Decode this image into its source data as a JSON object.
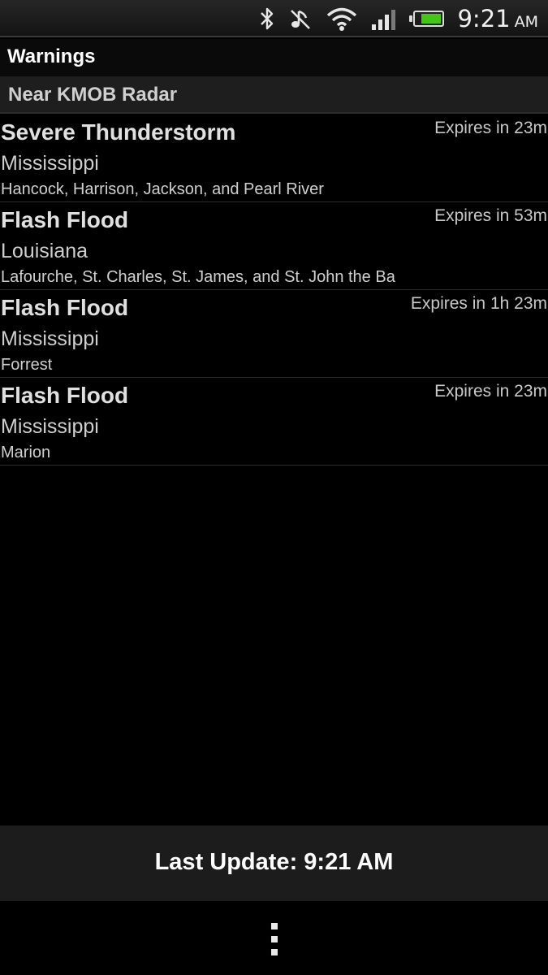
{
  "status_bar": {
    "time": "9:21",
    "ampm": "AM",
    "icons": [
      "bluetooth-icon",
      "muted-icon",
      "wifi-icon",
      "signal-icon",
      "battery-icon"
    ],
    "battery_color": "#45c41a",
    "battery_level": 0.85
  },
  "title_bar": {
    "title": "Warnings"
  },
  "section": {
    "header": "Near KMOB Radar"
  },
  "warnings": [
    {
      "type": "Severe Thunderstorm",
      "expires": "Expires in 23m",
      "state": "Mississippi",
      "counties": "Hancock, Harrison, Jackson, and Pearl River"
    },
    {
      "type": "Flash Flood",
      "expires": "Expires in 53m",
      "state": "Louisiana",
      "counties": "Lafourche, St. Charles, St. James, and St. John the Ba"
    },
    {
      "type": "Flash Flood",
      "expires": "Expires in 1h 23m",
      "state": "Mississippi",
      "counties": "Forrest"
    },
    {
      "type": "Flash Flood",
      "expires": "Expires in 23m",
      "state": "Mississippi",
      "counties": "Marion"
    }
  ],
  "footer": {
    "last_update": "Last Update: 9:21 AM"
  },
  "nav_bar": {
    "menu_icon": "overflow-menu-icon"
  }
}
